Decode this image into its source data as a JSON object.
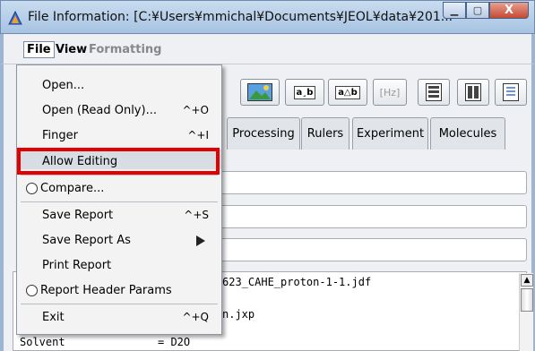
{
  "window": {
    "title": "File Information: [C:¥Users¥mmichal¥Documents¥JEOL¥data¥201...",
    "minimize": "▁",
    "maximize": "▢",
    "close": "X"
  },
  "menubar": {
    "file": "File",
    "view": "View",
    "formatting": "Formatting"
  },
  "file_menu": {
    "open": "Open...",
    "open_ro": "Open (Read Only)...",
    "open_ro_sc": "^+O",
    "finger": "Finger",
    "finger_sc": "^+I",
    "allow_editing": "Allow Editing",
    "compare": "Compare...",
    "save_report": "Save Report",
    "save_report_sc": "^+S",
    "save_report_as": "Save Report As",
    "print_report": "Print Report",
    "report_header": "Report Header Params",
    "exit": "Exit",
    "exit_sc": "^+Q"
  },
  "toolbar": {
    "hz": "[Hz]",
    "abc": "a¸b",
    "adelta": "a△b"
  },
  "tabs": {
    "processing": "Processing",
    "rulers": "Rulers",
    "experiment": "Experiment",
    "molecules": "Molecules"
  },
  "text": {
    "line1": "623_CAHE_proton-1-1.jdf",
    "line2": "n.jxp",
    "solvent_key": "Solvent",
    "solvent_val": "= D2O"
  },
  "colors": {
    "highlight": "#e20000"
  }
}
